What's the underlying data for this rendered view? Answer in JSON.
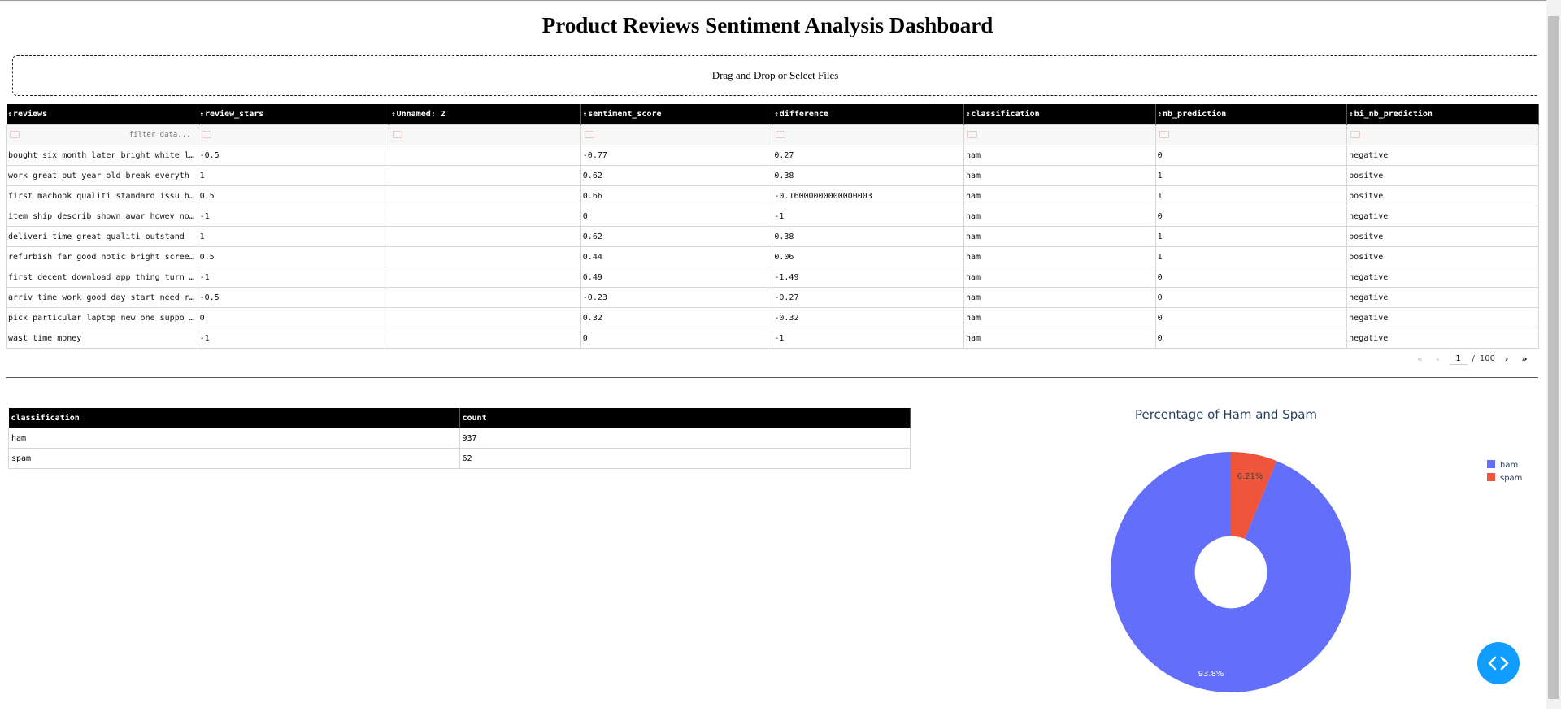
{
  "title": "Product Reviews Sentiment Analysis Dashboard",
  "upload": {
    "label": "Drag and Drop or Select Files"
  },
  "table": {
    "sort_icon": "⇕",
    "columns": [
      "reviews",
      "review_stars",
      "Unnamed: 2",
      "sentiment_score",
      "difference",
      "classification",
      "nb_prediction",
      "bi_nb_prediction"
    ],
    "filter_placeholder": "filter data...",
    "rows": [
      [
        "bought six month later bright white l…",
        "-0.5",
        "",
        "-0.77",
        "0.27",
        "ham",
        "0",
        "negative"
      ],
      [
        "work great put year old break everyth",
        "1",
        "",
        "0.62",
        "0.38",
        "ham",
        "1",
        "positve"
      ],
      [
        "first macbook qualiti standard issu b…",
        "0.5",
        "",
        "0.66",
        "-0.16000000000000003",
        "ham",
        "1",
        "positve"
      ],
      [
        "item ship describ shown awar howev no…",
        "-1",
        "",
        "0",
        "-1",
        "ham",
        "0",
        "negative"
      ],
      [
        "deliveri time great qualiti outstand",
        "1",
        "",
        "0.62",
        "0.38",
        "ham",
        "1",
        "positve"
      ],
      [
        "refurbish far good notic bright scree…",
        "0.5",
        "",
        "0.44",
        "0.06",
        "ham",
        "1",
        "positve"
      ],
      [
        "first decent download app thing turn …",
        "-1",
        "",
        "0.49",
        "-1.49",
        "ham",
        "0",
        "negative"
      ],
      [
        "arriv time work good day start need r…",
        "-0.5",
        "",
        "-0.23",
        "-0.27",
        "ham",
        "0",
        "negative"
      ],
      [
        "pick particular laptop new one suppo …",
        "0",
        "",
        "0.32",
        "-0.32",
        "ham",
        "0",
        "negative"
      ],
      [
        "wast time money",
        "-1",
        "",
        "0",
        "-1",
        "ham",
        "0",
        "negative"
      ]
    ]
  },
  "pagination": {
    "first": "«",
    "prev": "‹",
    "current": "1",
    "separator": "/",
    "total": "100",
    "next": "›",
    "last": "»"
  },
  "count_table": {
    "columns": [
      "classification",
      "count"
    ],
    "rows": [
      [
        "ham",
        "937"
      ],
      [
        "spam",
        "62"
      ]
    ]
  },
  "chart_data": {
    "type": "pie",
    "title": "Percentage of Ham and Spam",
    "hole": 0.3,
    "categories": [
      "ham",
      "spam"
    ],
    "values": [
      937,
      62
    ],
    "labels": [
      "93.8%",
      "6.21%"
    ],
    "colors": [
      "#636efa",
      "#ef553b"
    ],
    "legend_position": "top-right"
  },
  "icons": {
    "fab": "code-brackets-icon"
  }
}
